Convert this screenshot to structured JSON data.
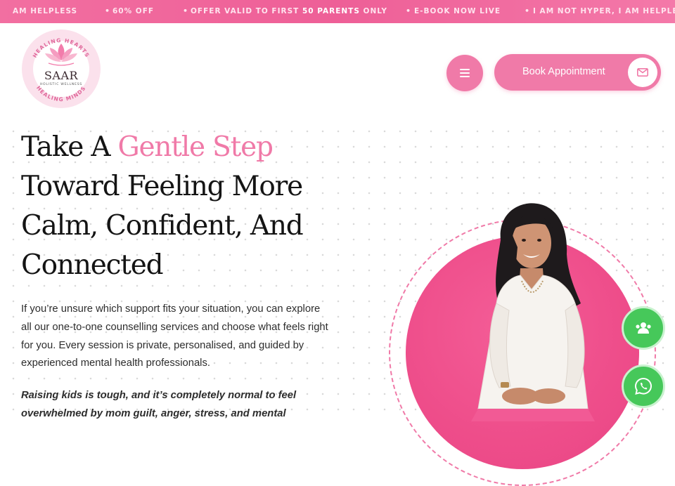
{
  "ticker": {
    "items": [
      {
        "pre": "AM HELPLESS",
        "hl": "",
        "post": ""
      },
      {
        "pre": "60% OFF",
        "hl": "",
        "post": ""
      },
      {
        "pre": "OFFER VALID TO FIRST ",
        "hl": "50 PARENTS",
        "post": " ONLY"
      },
      {
        "pre": "E-BOOK NOW LIVE",
        "hl": "",
        "post": ""
      },
      {
        "pre": "I AM NOT HYPER, I AM HELPLESS",
        "hl": "",
        "post": ""
      }
    ]
  },
  "header": {
    "logo": {
      "top_text": "HEALING HEARTS",
      "bottom_text": "HEALING MINDS",
      "name": "SAAR",
      "sub": "HOLISTIC WELLNESS"
    },
    "menu_icon": "hamburger-icon",
    "book_label": "Book Appointment",
    "book_icon": "envelope-icon"
  },
  "hero": {
    "title_line1_pre": "Take A ",
    "title_line1_accent": "Gentle Step",
    "title_rest": "Toward Feeling More Calm, Confident, And Connected",
    "paragraph": "If you’re unsure which support fits your situation, you can explore all our one-to-one counselling services and choose what feels right for you. Every session is private, personalised, and guided by experienced mental health professionals.",
    "emphasis": "Raising kids is tough, and it’s completely normal to feel overwhelmed by mom guilt, anger, stress, and mental"
  },
  "floating": {
    "group_icon": "users-icon",
    "whatsapp_icon": "whatsapp-icon"
  },
  "colors": {
    "accent": "#f07aa8",
    "ticker": "#ee5f97",
    "disc": "#ee4d8a",
    "float": "#46c85a"
  }
}
